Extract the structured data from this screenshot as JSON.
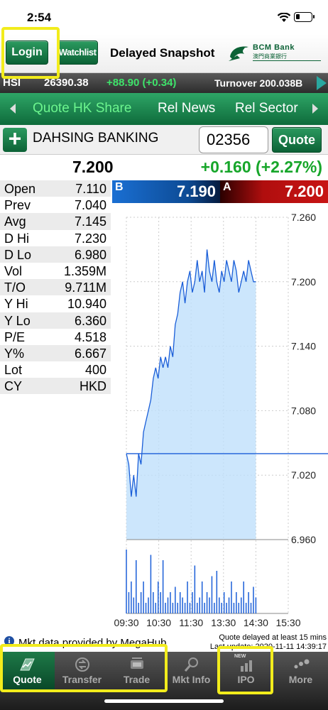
{
  "status_bar": {
    "time": "2:54"
  },
  "header": {
    "login_label": "Login",
    "watchlist_label": "Watchlist",
    "title": "Delayed Snapshot",
    "logo_text": "BCM Bank",
    "logo_subtext": "澳門商業銀行"
  },
  "index_bar": {
    "name": "HSI",
    "value": "26390.38",
    "change": "+88.90 (+0.34)",
    "turnover": "Turnover 200.038B"
  },
  "tabs": [
    {
      "label": "Quote HK Share",
      "active": true
    },
    {
      "label": "Rel News",
      "active": false
    },
    {
      "label": "Rel Sector",
      "active": false
    }
  ],
  "search": {
    "stock_name": "DAHSING BANKING",
    "code": "02356",
    "quote_label": "Quote"
  },
  "quote": {
    "price": "7.200",
    "change": "+0.160 (+2.27%)"
  },
  "stats": [
    {
      "label": "Open",
      "value": "7.110"
    },
    {
      "label": "Prev",
      "value": "7.040"
    },
    {
      "label": "Avg",
      "value": "7.145"
    },
    {
      "label": "D Hi",
      "value": "7.230"
    },
    {
      "label": "D Lo",
      "value": "6.980"
    },
    {
      "label": "Vol",
      "value": "1.359M"
    },
    {
      "label": "T/O",
      "value": "9.711M"
    },
    {
      "label": "Y Hi",
      "value": "10.940"
    },
    {
      "label": "Y Lo",
      "value": "6.360"
    },
    {
      "label": "P/E",
      "value": "4.518"
    },
    {
      "label": "Y%",
      "value": "6.667"
    },
    {
      "label": "Lot",
      "value": "400"
    },
    {
      "label": "CY",
      "value": "HKD"
    }
  ],
  "bid": {
    "letter": "B",
    "price": "7.190"
  },
  "ask": {
    "letter": "A",
    "price": "7.200"
  },
  "chart_data": {
    "type": "line",
    "prev_close": 7.04,
    "ylim": [
      6.96,
      7.26
    ],
    "yticks": [
      "7.260",
      "7.200",
      "7.140",
      "7.080",
      "7.020",
      "6.960"
    ],
    "xticks": [
      "09:30",
      "10:30",
      "11:30",
      "13:30",
      "14:30",
      "15:30"
    ],
    "price_series": [
      7.04,
      7.03,
      7.0,
      7.02,
      7.0,
      7.04,
      7.03,
      7.06,
      7.07,
      7.08,
      7.09,
      7.11,
      7.12,
      7.11,
      7.13,
      7.12,
      7.13,
      7.12,
      7.14,
      7.13,
      7.16,
      7.17,
      7.19,
      7.2,
      7.18,
      7.2,
      7.21,
      7.19,
      7.2,
      7.22,
      7.2,
      7.21,
      7.19,
      7.23,
      7.21,
      7.2,
      7.22,
      7.2,
      7.19,
      7.21,
      7.2,
      7.22,
      7.21,
      7.2,
      7.22,
      7.21,
      7.19,
      7.2,
      7.21,
      7.2,
      7.22,
      7.21,
      7.2,
      7.2
    ],
    "volume_series": [
      0.6,
      0.2,
      0.3,
      0.15,
      0.5,
      0.1,
      0.2,
      0.3,
      0.1,
      0.15,
      0.55,
      0.2,
      0.1,
      0.3,
      0.2,
      0.5,
      0.1,
      0.15,
      0.2,
      0.1,
      0.25,
      0.1,
      0.2,
      0.15,
      0.1,
      0.3,
      0.1,
      0.2,
      0.45,
      0.1,
      0.15,
      0.3,
      0.1,
      0.2,
      0.15,
      0.35,
      0.1,
      0.4,
      0.15,
      0.1,
      0.2,
      0.1,
      0.15,
      0.3,
      0.1,
      0.2,
      0.1,
      0.15,
      0.3,
      0.1,
      0.2,
      0.1,
      0.25,
      0.15
    ],
    "line_color": "#1a5ed8",
    "fill_color": "#bfe0fb",
    "grid": true
  },
  "footer": {
    "provider": "Mkt data provided by MegaHub",
    "delay_notice": "Quote delayed at least 15 mins",
    "last_update": "Last update: 2020-11-11 14:39:17"
  },
  "bottom_nav": [
    {
      "label": "Quote",
      "icon": "quote-icon",
      "active": true
    },
    {
      "label": "Transfer",
      "icon": "transfer-icon",
      "active": false
    },
    {
      "label": "Trade",
      "icon": "trade-icon",
      "active": false
    },
    {
      "label": "Mkt Info",
      "icon": "mkt-info-icon",
      "active": false
    },
    {
      "label": "IPO",
      "icon": "ipo-icon",
      "badge": "NEW",
      "active": false
    },
    {
      "label": "More",
      "icon": "more-icon",
      "active": false
    }
  ],
  "colors": {
    "brand_green": "#0c6236",
    "highlight": "#f2ec1c",
    "up_green": "#17a62a",
    "bid_blue": "#1a6fd3",
    "ask_red": "#c81414"
  }
}
